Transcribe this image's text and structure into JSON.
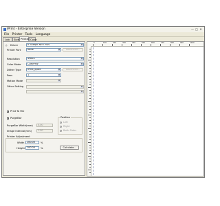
{
  "window": {
    "title": "iPrint - Enterprise Version"
  },
  "menu": [
    "File",
    "Printer",
    "Tools",
    "Language"
  ],
  "tabs": [
    {
      "label": "Job Info",
      "active": false
    },
    {
      "label": "Size",
      "active": false
    },
    {
      "label": "Printer",
      "active": true
    },
    {
      "label": "Color",
      "active": false
    }
  ],
  "printer": {
    "driver_label": "Driver",
    "driver_value": "A Sharpit NEO Plus",
    "port_label": "Printer Port",
    "port_value": "None",
    "advanced_label": "Advanced...",
    "resolution_label": "Resolution",
    "resolution_value": "4PASS",
    "color_mode_label": "Color Mode",
    "color_mode_value": "CDKMYW",
    "dither_label": "Dither Type",
    "dither_value": "iPrint_quick",
    "advanced2_label": "Advanced...",
    "pass_label": "Pass",
    "pass_value": "1",
    "motion_label": "Motion Mode",
    "motion_value": "",
    "other_label": "Other Setting",
    "other_value": "",
    "other_value_2": ""
  },
  "options": {
    "print_to_file_label": "Print To File",
    "purgebar_label": "PurgeBar",
    "position_group_label": "Position",
    "position_options": [
      "Left",
      "Right",
      "Both Sides"
    ],
    "purgebar_width_label": "PurgeBar Width(mm)",
    "purgebar_width_value": "0.00",
    "image_interval_label": "Image Interval(mm)",
    "image_interval_value": "1.00"
  },
  "adjustment": {
    "group_label": "Printer Adjustment",
    "width_label": "Width",
    "width_value": "100.00",
    "width_unit": "%",
    "height_label": "Height",
    "height_value": "100.00",
    "height_unit": "%",
    "calculate_label": "Calculate..."
  },
  "ruler": {
    "labels": [
      "0",
      "100",
      "200",
      "300",
      "400",
      "500",
      "600",
      "700",
      "800",
      "900",
      "1000"
    ]
  }
}
